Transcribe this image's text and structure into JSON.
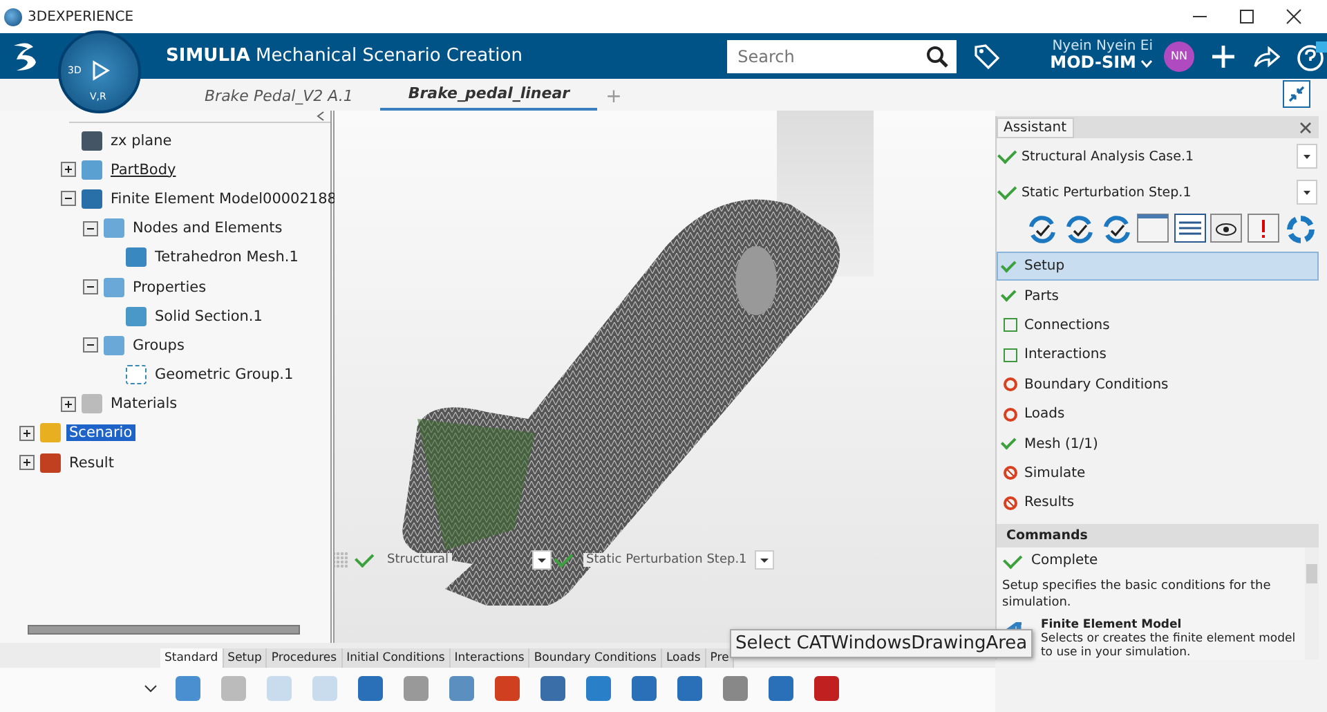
{
  "window": {
    "title": "3DEXPERIENCE"
  },
  "header": {
    "app_title": "**SIMULIA** Mechanical Scenario Creation",
    "compass": {
      "left": "3D",
      "bottom": "V,R"
    },
    "search": {
      "placeholder": "Search"
    },
    "user": {
      "name": "Nyein Nyein Ei",
      "role": "MOD-SIM",
      "initials": "NN"
    }
  },
  "doc_tabs": [
    {
      "label": "Brake Pedal_V2 A.1",
      "selected": false
    },
    {
      "label": "Brake_pedal_linear",
      "selected": true
    }
  ],
  "new_tab": "+",
  "tree": {
    "nested_items": [
      {
        "label": "zx plane",
        "kind": "plane",
        "selected": false
      },
      {
        "label": "PartBody",
        "kind": "body",
        "expanded": false,
        "selected": false
      },
      {
        "label": "Finite Element Model00002188",
        "kind": "fem",
        "expanded": true,
        "selected": false,
        "children": [
          {
            "label": "Nodes and Elements",
            "kind": "box",
            "expanded": true,
            "selected": false,
            "children": [
              {
                "label": "Tetrahedron Mesh.1",
                "kind": "tetra",
                "selected": false
              }
            ]
          },
          {
            "label": "Properties",
            "kind": "box",
            "expanded": true,
            "selected": false,
            "children": [
              {
                "label": "Solid Section.1",
                "kind": "cube",
                "selected": false
              }
            ]
          },
          {
            "label": "Groups",
            "kind": "box",
            "expanded": true,
            "selected": false,
            "children": [
              {
                "label": "Geometric Group.1",
                "kind": "group",
                "selected": false
              }
            ]
          }
        ]
      },
      {
        "label": "Materials",
        "kind": "folder",
        "expanded": false,
        "selected": false
      }
    ],
    "items": [
      {
        "label": "Scenario",
        "kind": "scenario",
        "expanded": false,
        "selected": true
      },
      {
        "label": "Result",
        "kind": "result",
        "expanded": false,
        "selected": false
      }
    ]
  },
  "viewport": {
    "case_label": "Structural",
    "step_label": "Static Perturbation Step.1",
    "tooltip": "Select CATWindowsDrawingArea"
  },
  "assistant": {
    "title": "Assistant",
    "case": "Structural Analysis Case.1",
    "step": "Static Perturbation Step.1",
    "steps": [
      {
        "label": "Setup",
        "kind": "done",
        "selected": true
      },
      {
        "label": "Parts",
        "kind": "done",
        "selected": false
      },
      {
        "label": "Connections",
        "kind": "todo",
        "selected": false
      },
      {
        "label": "Interactions",
        "kind": "todo",
        "selected": false
      },
      {
        "label": "Boundary Conditions",
        "kind": "required",
        "selected": false
      },
      {
        "label": "Loads",
        "kind": "required",
        "selected": false
      },
      {
        "label": "Mesh (1/1)",
        "kind": "done",
        "selected": false
      },
      {
        "label": "Simulate",
        "kind": "blocked",
        "selected": false
      },
      {
        "label": "Results",
        "kind": "blocked",
        "selected": false
      }
    ],
    "commands_title": "Commands",
    "status": "Complete",
    "description": "Setup specifies the basic conditions for the simulation.",
    "command": {
      "title": "Finite Element Model",
      "text": "Selects or creates the finite element model to use in your simulation."
    }
  },
  "toolbar_tabs": [
    {
      "label": "Standard",
      "selected": true
    },
    {
      "label": "Setup",
      "selected": false
    },
    {
      "label": "Procedures",
      "selected": false
    },
    {
      "label": "Initial Conditions",
      "selected": false
    },
    {
      "label": "Interactions",
      "selected": false
    },
    {
      "label": "Boundary Conditions",
      "selected": false
    },
    {
      "label": "Loads",
      "selected": false
    },
    {
      "label": "Pre",
      "selected": false
    }
  ]
}
